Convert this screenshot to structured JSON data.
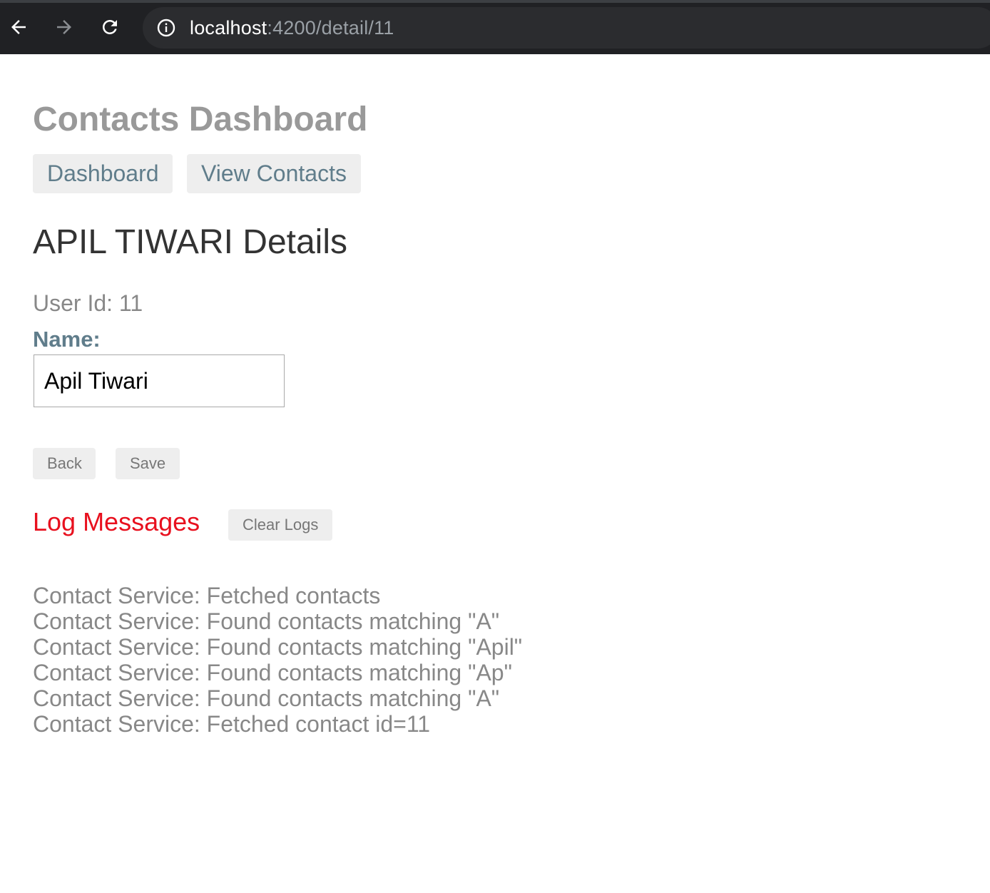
{
  "browser": {
    "url_host": "localhost",
    "url_path": ":4200/detail/11",
    "icons": {
      "back": "arrow-left-icon",
      "forward": "arrow-right-icon",
      "reload": "reload-icon",
      "info": "info-icon"
    }
  },
  "app": {
    "title": "Contacts Dashboard",
    "nav": [
      {
        "label": "Dashboard"
      },
      {
        "label": "View Contacts"
      }
    ]
  },
  "detail": {
    "title": "APIL TIWARI Details",
    "user_id_text": "User Id: 11",
    "name_label": "Name:",
    "name_value": "Apil Tiwari",
    "back_label": "Back",
    "save_label": "Save"
  },
  "logs": {
    "title": "Log Messages",
    "clear_label": "Clear Logs",
    "messages": [
      "Contact Service: Fetched contacts",
      "Contact Service: Found contacts matching \"A\"",
      "Contact Service: Found contacts matching \"Apil\"",
      "Contact Service: Found contacts matching \"Ap\"",
      "Contact Service: Found contacts matching \"A\"",
      "Contact Service: Fetched contact id=11"
    ]
  },
  "colors": {
    "title_gray": "#999999",
    "nav_text": "#607d8b",
    "log_title_red": "#e8101e",
    "browser_bar": "#202124"
  }
}
